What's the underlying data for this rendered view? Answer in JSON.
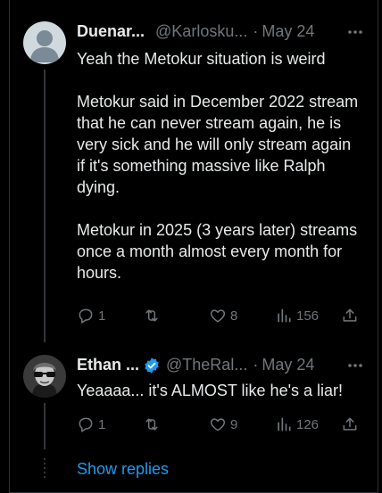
{
  "tweets": [
    {
      "name": "Duenar...",
      "handle": "@Karlosku...",
      "separator": "·",
      "date": "May 24",
      "text": "Yeah the Metokur situation is weird\n\nMetokur said in December 2022 stream that he can never stream again, he is very sick and he will only stream again if it's something massive like Ralph dying.\n\nMetokur in 2025 (3 years later) streams once a month almost every month for hours.",
      "replies": "1",
      "retweets": "",
      "likes": "8",
      "views": "156",
      "verified": false
    },
    {
      "name": "Ethan ...",
      "handle": "@TheRal...",
      "separator": "·",
      "date": "May 24",
      "text": "Yeaaaa... it's ALMOST like he's a liar!",
      "replies": "1",
      "retweets": "",
      "likes": "9",
      "views": "126",
      "verified": true
    }
  ],
  "show_replies_label": "Show replies",
  "colors": {
    "background": "#000000",
    "text": "#e7e9ea",
    "muted": "#71767b",
    "link": "#1d9bf0",
    "verified": "#1d9bf0"
  },
  "icons": [
    "more-icon",
    "reply-icon",
    "retweet-icon",
    "like-icon",
    "views-icon",
    "share-icon",
    "verified-badge-icon"
  ]
}
